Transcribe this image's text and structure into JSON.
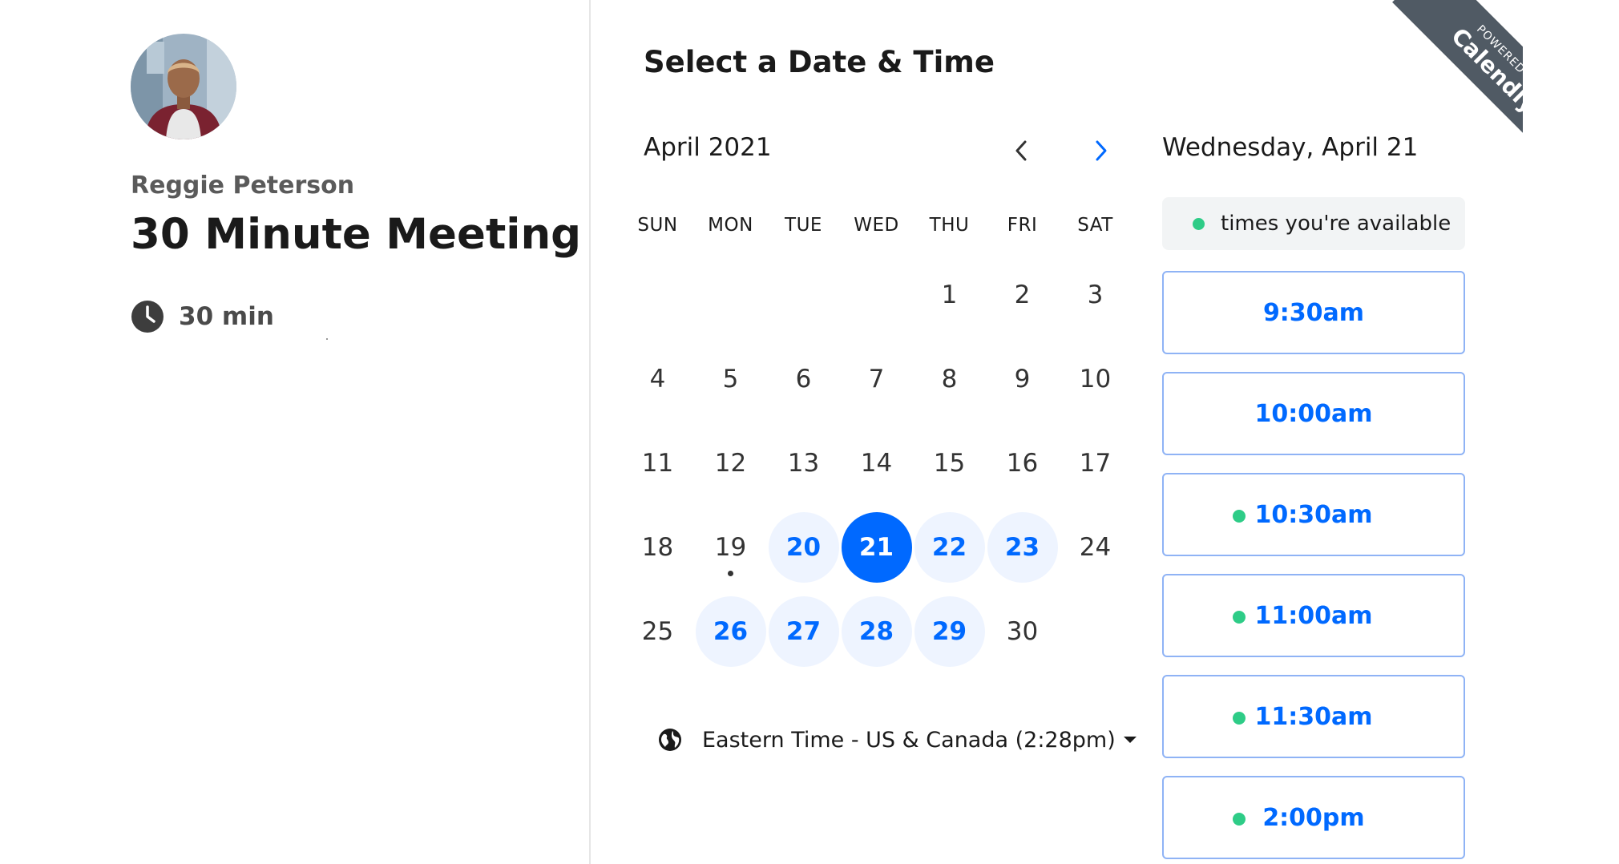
{
  "organizer": {
    "name": "Reggie Peterson"
  },
  "event": {
    "name": "30 Minute Meeting",
    "duration": "30 min"
  },
  "header": {
    "title": "Select a Date & Time"
  },
  "calendar": {
    "month_label": "April 2021",
    "weekdays": [
      "SUN",
      "MON",
      "TUE",
      "WED",
      "THU",
      "FRI",
      "SAT"
    ],
    "first_weekday_index": 4,
    "days": [
      {
        "n": "1",
        "state": "default"
      },
      {
        "n": "2",
        "state": "default"
      },
      {
        "n": "3",
        "state": "default"
      },
      {
        "n": "4",
        "state": "default"
      },
      {
        "n": "5",
        "state": "default"
      },
      {
        "n": "6",
        "state": "default"
      },
      {
        "n": "7",
        "state": "default"
      },
      {
        "n": "8",
        "state": "default"
      },
      {
        "n": "9",
        "state": "default"
      },
      {
        "n": "10",
        "state": "default"
      },
      {
        "n": "11",
        "state": "default"
      },
      {
        "n": "12",
        "state": "default"
      },
      {
        "n": "13",
        "state": "default"
      },
      {
        "n": "14",
        "state": "default"
      },
      {
        "n": "15",
        "state": "default"
      },
      {
        "n": "16",
        "state": "default"
      },
      {
        "n": "17",
        "state": "default"
      },
      {
        "n": "18",
        "state": "default"
      },
      {
        "n": "19",
        "state": "today"
      },
      {
        "n": "20",
        "state": "available"
      },
      {
        "n": "21",
        "state": "selected"
      },
      {
        "n": "22",
        "state": "available"
      },
      {
        "n": "23",
        "state": "available"
      },
      {
        "n": "24",
        "state": "default"
      },
      {
        "n": "25",
        "state": "default"
      },
      {
        "n": "26",
        "state": "available"
      },
      {
        "n": "27",
        "state": "available"
      },
      {
        "n": "28",
        "state": "available"
      },
      {
        "n": "29",
        "state": "available"
      },
      {
        "n": "30",
        "state": "default"
      }
    ]
  },
  "timezone": {
    "label": "Eastern Time - US & Canada (2:28pm)"
  },
  "times": {
    "selected_date": "Wednesday, April 21",
    "legend": "times you're available",
    "slots": [
      {
        "time": "9:30am",
        "dot": false
      },
      {
        "time": "10:00am",
        "dot": false
      },
      {
        "time": "10:30am",
        "dot": true
      },
      {
        "time": "11:00am",
        "dot": true
      },
      {
        "time": "11:30am",
        "dot": true
      },
      {
        "time": "2:00pm",
        "dot": true
      }
    ]
  },
  "ribbon": {
    "line1": "POWERED BY",
    "line2": "Calendly"
  },
  "colors": {
    "accent": "#0069ff",
    "available_bg": "#eef4ff",
    "legend_dot": "#2ecc87",
    "ribbon": "#505a64"
  },
  "icons": {
    "clock": "clock-icon",
    "globe": "globe-icon",
    "prev": "chevron-left-icon",
    "next": "chevron-right-icon"
  }
}
